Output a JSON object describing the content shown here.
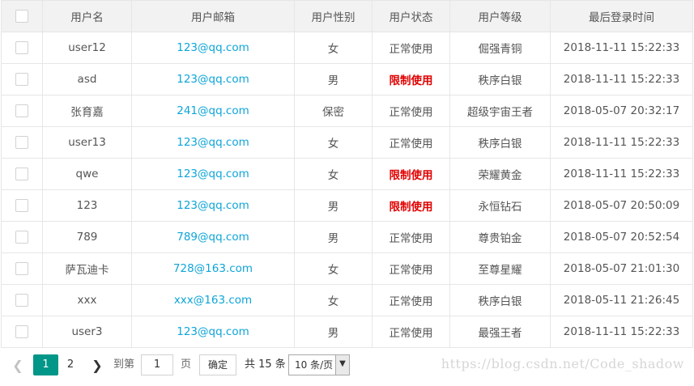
{
  "table": {
    "headers": [
      "用户名",
      "用户邮箱",
      "用户性别",
      "用户状态",
      "用户等级",
      "最后登录时间"
    ],
    "rows": [
      {
        "name": "user12",
        "email": "123@qq.com",
        "gender": "女",
        "status": "正常使用",
        "restricted": false,
        "level": "倔强青铜",
        "last_login": "2018-11-11 15:22:33"
      },
      {
        "name": "asd",
        "email": "123@qq.com",
        "gender": "男",
        "status": "限制使用",
        "restricted": true,
        "level": "秩序白银",
        "last_login": "2018-11-11 15:22:33"
      },
      {
        "name": "张育嘉",
        "email": "241@qq.com",
        "gender": "保密",
        "status": "正常使用",
        "restricted": false,
        "level": "超级宇宙王者",
        "last_login": "2018-05-07 20:32:17"
      },
      {
        "name": "user13",
        "email": "123@qq.com",
        "gender": "女",
        "status": "正常使用",
        "restricted": false,
        "level": "秩序白银",
        "last_login": "2018-11-11 15:22:33"
      },
      {
        "name": "qwe",
        "email": "123@qq.com",
        "gender": "女",
        "status": "限制使用",
        "restricted": true,
        "level": "荣耀黄金",
        "last_login": "2018-11-11 15:22:33"
      },
      {
        "name": "123",
        "email": "123@qq.com",
        "gender": "男",
        "status": "限制使用",
        "restricted": true,
        "level": "永恒钻石",
        "last_login": "2018-05-07 20:50:09"
      },
      {
        "name": "789",
        "email": "789@qq.com",
        "gender": "男",
        "status": "正常使用",
        "restricted": false,
        "level": "尊贵铂金",
        "last_login": "2018-05-07 20:52:54"
      },
      {
        "name": "萨瓦迪卡",
        "email": "728@163.com",
        "gender": "女",
        "status": "正常使用",
        "restricted": false,
        "level": "至尊星耀",
        "last_login": "2018-05-07 21:01:30"
      },
      {
        "name": "xxx",
        "email": "xxx@163.com",
        "gender": "女",
        "status": "正常使用",
        "restricted": false,
        "level": "秩序白银",
        "last_login": "2018-05-11 21:26:45"
      },
      {
        "name": "user3",
        "email": "123@qq.com",
        "gender": "男",
        "status": "正常使用",
        "restricted": false,
        "level": "最强王者",
        "last_login": "2018-11-11 15:22:33"
      }
    ]
  },
  "pager": {
    "prev_icon": "chevron-left-icon",
    "current_page": "1",
    "page_2": "2",
    "next_icon": "chevron-right-icon",
    "goto_label": "到第",
    "goto_value": "1",
    "page_suffix": "页",
    "confirm_label": "确定",
    "total_label": "共 15 条",
    "page_size": "10 条/页"
  },
  "watermark": "https://blog.csdn.net/Code_shadow",
  "colors": {
    "accent": "#009688",
    "email": "#0ea5d8",
    "restricted": "#e00000",
    "header_bg": "#f2f2f2"
  }
}
